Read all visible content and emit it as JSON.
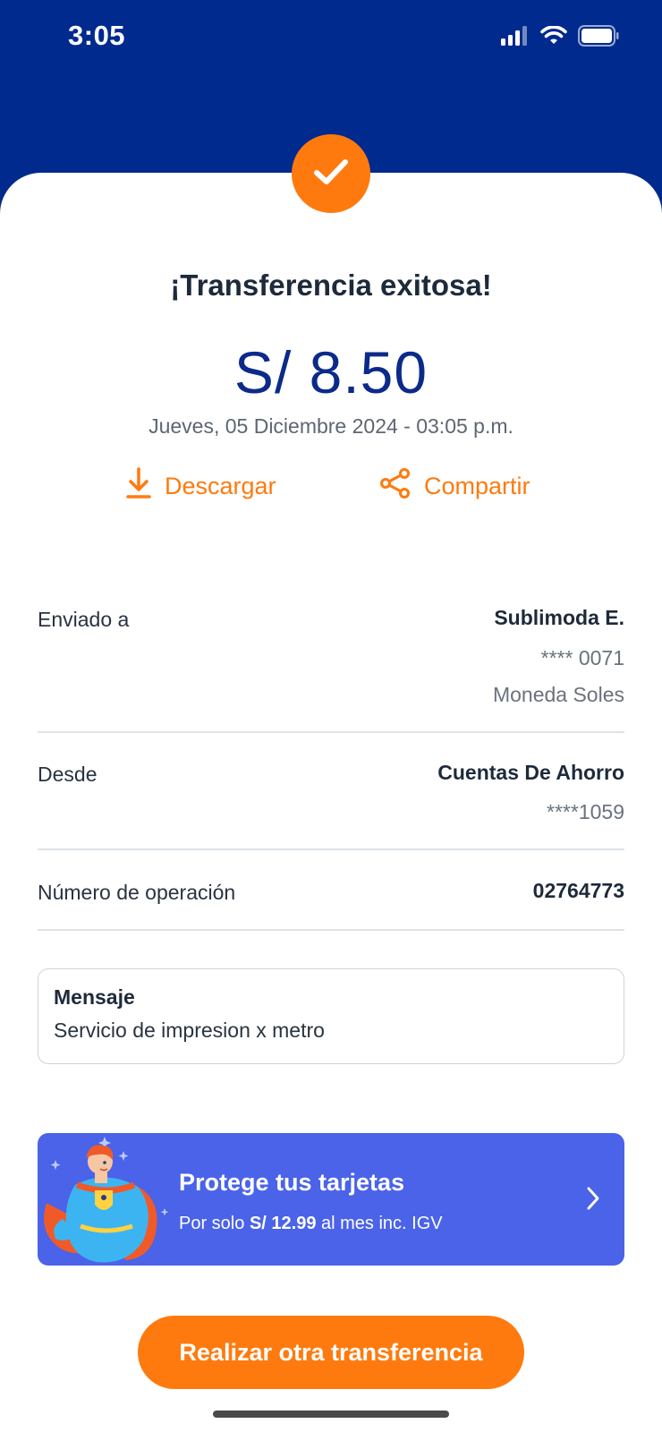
{
  "status_bar": {
    "time": "3:05",
    "icons": [
      "signal-icon",
      "wifi-icon",
      "battery-icon"
    ]
  },
  "colors": {
    "header": "#002a8d",
    "accent": "#ff7a0e",
    "amount": "#0b2a8a",
    "promo": "#4a63e8"
  },
  "result": {
    "icon": "checkmark-icon",
    "title": "¡Transferencia exitosa!",
    "amount": "S/ 8.50",
    "date": "Jueves, 05 Diciembre 2024 - 03:05 p.m."
  },
  "actions": {
    "download_label": "Descargar",
    "download_icon": "download-icon",
    "share_label": "Compartir",
    "share_icon": "share-icon"
  },
  "details": {
    "sent_to": {
      "label": "Enviado a",
      "name": "Sublimoda E.",
      "account": "**** 0071",
      "currency": "Moneda Soles"
    },
    "from": {
      "label": "Desde",
      "account_type": "Cuentas De Ahorro",
      "account": "****1059"
    },
    "operation": {
      "label": "Número de operación",
      "number": "02764773"
    }
  },
  "message": {
    "title": "Mensaje",
    "text": "Servicio de impresion x metro"
  },
  "promo": {
    "title": "Protege tus tarjetas",
    "sub_prefix": "Por solo ",
    "sub_price": "S/ 12.99",
    "sub_suffix": " al mes inc. IGV",
    "icon": "chevron-right-icon"
  },
  "cta": {
    "label": "Realizar otra transferencia"
  }
}
